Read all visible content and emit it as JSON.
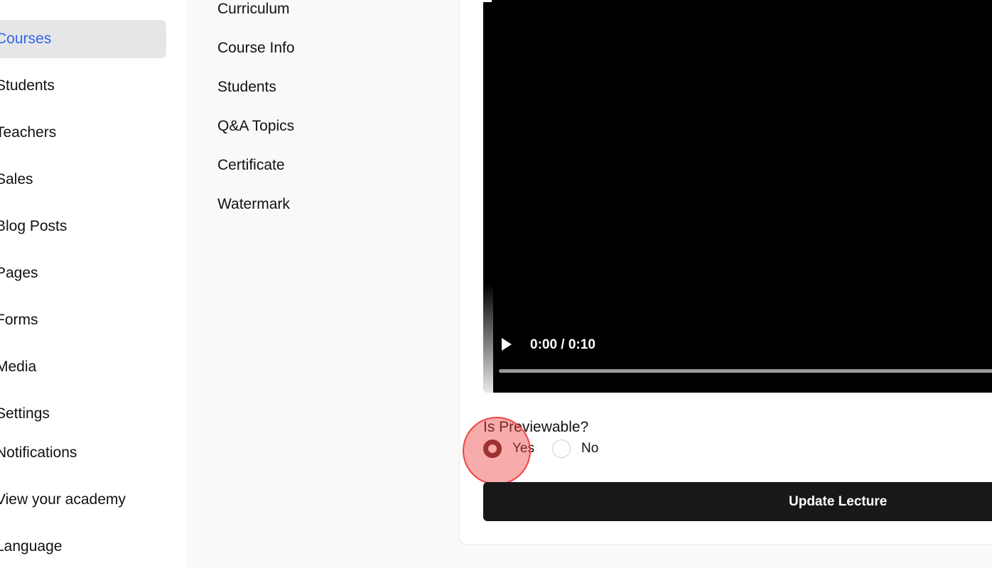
{
  "sidebar": {
    "items": [
      {
        "label": "Courses",
        "active": true
      },
      {
        "label": "Students"
      },
      {
        "label": "Teachers"
      },
      {
        "label": "Sales"
      },
      {
        "label": "Blog Posts"
      },
      {
        "label": "Pages"
      },
      {
        "label": "Forms"
      },
      {
        "label": "Media"
      },
      {
        "label": "Settings"
      },
      {
        "label": "Notifications"
      },
      {
        "label": "View your academy"
      },
      {
        "label": "Language"
      }
    ]
  },
  "course_nav": {
    "items": [
      "Curriculum",
      "Course Info",
      "Students",
      "Q&A Topics",
      "Certificate",
      "Watermark"
    ]
  },
  "video": {
    "time": "0:00 / 0:10",
    "play_icon": "play-icon"
  },
  "lecture_form": {
    "previewable_label": "Is Previewable?",
    "options": [
      {
        "label": "Yes",
        "checked": true
      },
      {
        "label": "No",
        "checked": false
      }
    ],
    "submit_label": "Update Lecture"
  },
  "colors": {
    "accent": "#2f66e8",
    "radio_checked": "#5a1f1f",
    "button_bg": "#18181a",
    "click_indicator": "#ef4444"
  }
}
